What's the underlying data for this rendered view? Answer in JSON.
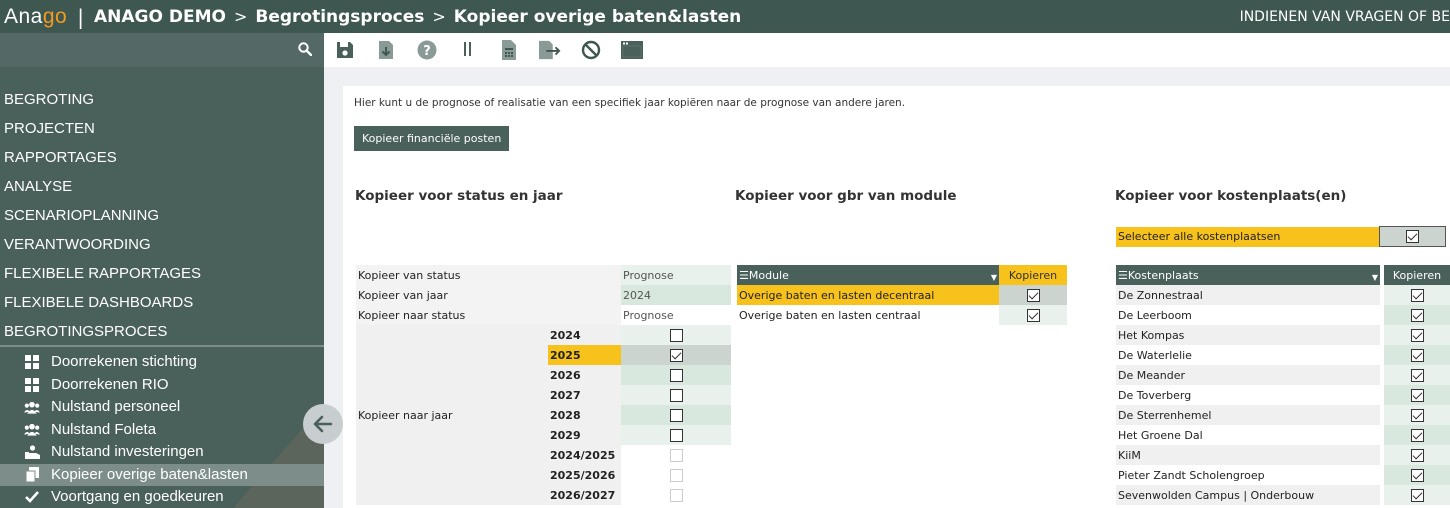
{
  "header": {
    "logo_a": "Ana",
    "logo_b": "go",
    "separator": "|",
    "crumbs": [
      "ANAGO DEMO",
      "Begrotingsproces",
      "Kopieer overige baten&lasten"
    ],
    "arrow": ">",
    "right_text": "INDIENEN VAN VRAGEN OF BE"
  },
  "sidebar": {
    "nav": [
      "BEGROTING",
      "PROJECTEN",
      "RAPPORTAGES",
      "ANALYSE",
      "SCENARIOPLANNING",
      "VERANTWOORDING",
      "FLEXIBELE RAPPORTAGES",
      "FLEXIBELE DASHBOARDS",
      "BEGROTINGSPROCES"
    ],
    "sub": [
      {
        "label": "Doorrekenen stichting",
        "icon": "grid-icon"
      },
      {
        "label": "Doorrekenen RIO",
        "icon": "grid-icon"
      },
      {
        "label": "Nulstand personeel",
        "icon": "users-icon"
      },
      {
        "label": "Nulstand Foleta",
        "icon": "users-icon"
      },
      {
        "label": "Nulstand investeringen",
        "icon": "investment-icon"
      },
      {
        "label": "Kopieer overige baten&lasten",
        "icon": "copy-icon"
      },
      {
        "label": "Voortgang en goedkeuren",
        "icon": "check-icon"
      }
    ]
  },
  "main": {
    "intro": "Hier kunt u de prognose of realisatie van een specifiek jaar kopiëren naar de prognose van andere jaren.",
    "copy_button": "Kopieer financiële posten",
    "section_status": "Kopieer voor status en jaar",
    "section_module": "Kopieer voor gbr van module",
    "section_kp": "Kopieer voor kostenplaats(en)",
    "status": {
      "from_status_label": "Kopieer van status",
      "from_status_value": "Prognose",
      "from_year_label": "Kopieer van jaar",
      "from_year_value": "2024",
      "to_status_label": "Kopieer naar status",
      "to_status_value": "Prognose",
      "to_year_label": "Kopieer naar jaar",
      "years": [
        {
          "year": "2024",
          "checked": false,
          "disabled": false
        },
        {
          "year": "2025",
          "checked": true,
          "disabled": false
        },
        {
          "year": "2026",
          "checked": false,
          "disabled": false
        },
        {
          "year": "2027",
          "checked": false,
          "disabled": false
        },
        {
          "year": "2028",
          "checked": false,
          "disabled": false
        },
        {
          "year": "2029",
          "checked": false,
          "disabled": false
        },
        {
          "year": "2024/2025",
          "checked": false,
          "disabled": true
        },
        {
          "year": "2025/2026",
          "checked": false,
          "disabled": true
        },
        {
          "year": "2026/2027",
          "checked": false,
          "disabled": true
        }
      ]
    },
    "module": {
      "col_module": "Module",
      "col_copy": "Kopieren",
      "rows": [
        {
          "label": "Overige baten en lasten decentraal",
          "checked": true
        },
        {
          "label": "Overige baten en lasten centraal",
          "checked": true
        }
      ]
    },
    "kp": {
      "select_all": "Selecteer alle kostenplaatsen",
      "col_kp": "Kostenplaats",
      "col_copy": "Kopieren",
      "rows": [
        "De Zonnestraal",
        "De Leerboom",
        "Het Kompas",
        "De Waterlelie",
        "De Meander",
        "De Toverberg",
        "De Sterrenhemel",
        "Het Groene Dal",
        "KiiM",
        "Pieter Zandt Scholengroep",
        "Sevenwolden Campus | Onderbouw"
      ]
    }
  },
  "colors": {
    "brand": "#3f5751",
    "accent": "#f39b1e",
    "highlight": "#f7c21b"
  }
}
